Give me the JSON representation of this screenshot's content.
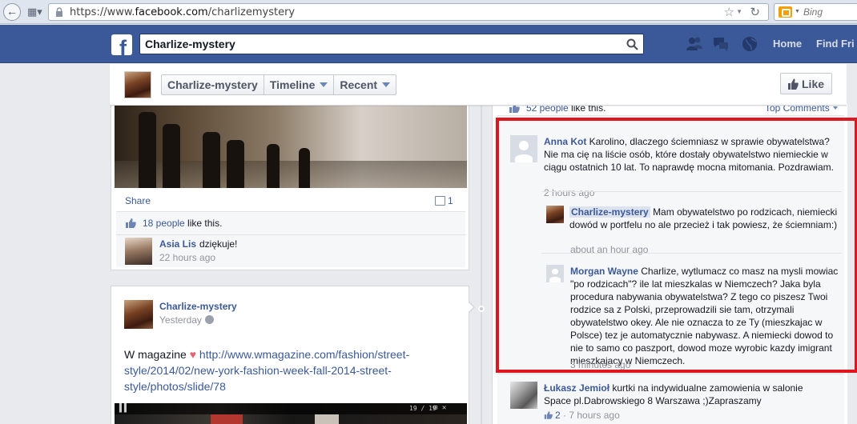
{
  "browser": {
    "url_prefix": "https://www.",
    "url_host": "facebook.com",
    "url_path": "/charlizemystery",
    "search_engine": "Bing"
  },
  "fb": {
    "logo_letter": "f",
    "search_value": "Charlize-mystery",
    "nav_home": "Home",
    "nav_find_friends": "Find Fri",
    "brand_color": "#3b5998"
  },
  "page_header": {
    "crumbs": [
      "Charlize-mystery",
      "Timeline",
      "Recent"
    ],
    "like_button": "Like"
  },
  "story1": {
    "share": "Share",
    "comment_count": "1",
    "likes_count": "18 people",
    "likes_suffix": " like this.",
    "comment": {
      "author": "Asia Lis",
      "text": "dziękuje!",
      "time": "22 hours ago"
    }
  },
  "story2": {
    "author": "Charlize-mystery",
    "time": "Yesterday",
    "text_prefix": "W magazine ",
    "heart": "♥",
    "url": "http://www.wmagazine.com/fashion/street-style/2014/02/new-york-fashion-week-fall-2014-street-style/photos/slide/78",
    "media_left_glyph": "▌▌",
    "media_counter": "19 / 19",
    "media_controls": "⊞ ✕"
  },
  "right_post": {
    "likes_count": "52 people",
    "likes_suffix": " like this.",
    "top_comments": "Top Comments",
    "comments": [
      {
        "author": "Anna Kot",
        "text": "Karolino, dlaczego ściemniasz w sprawie obywatelstwa? Nie ma cię na liście osób, które dostały obywatelstwo niemieckie w ciągu ostatnich 10 lat. To naprawdę mocna mitomania. Pozdrawiam.",
        "time": "2 hours ago"
      },
      {
        "author": "Charlize-mystery",
        "text": "Mam obywatelstwo po rodzicach, niemiecki dowód w portfelu no ale przecież i tak powiesz, że ściemniam:)",
        "time": "about an hour ago"
      },
      {
        "author": "Morgan Wayne",
        "text": "Charlize, wytlumacz co masz na mysli mowiac \"po rodzicach\"? ile lat mieszkalas w Niemczech? Jaka byla procedura nabywania obywatelstwa? Z tego co piszesz Twoi rodzice sa z Polski, przeprowadzili sie tam, otrzymali obywatelstwo okey. Ale nie oznacza to ze Ty (mieszkajac w Polsce) tez je automatycznie nabywasz. A niemiecki dowod to nie to samo co paszport, dowod moze wyrobic kazdy imigrant mieszkajacy w Niemczech.",
        "time": "3 minutes ago"
      },
      {
        "author": "Łukasz Jemioł",
        "text": "kurtki na indywidualne zamowienia w salonie Space pl.Dabrowskiego 8 Warszawa ;)Zapraszamy",
        "likes": "2",
        "separator": " · ",
        "time": "7 hours ago"
      }
    ]
  },
  "annotation": {
    "highlight_color": "#e0161f"
  }
}
